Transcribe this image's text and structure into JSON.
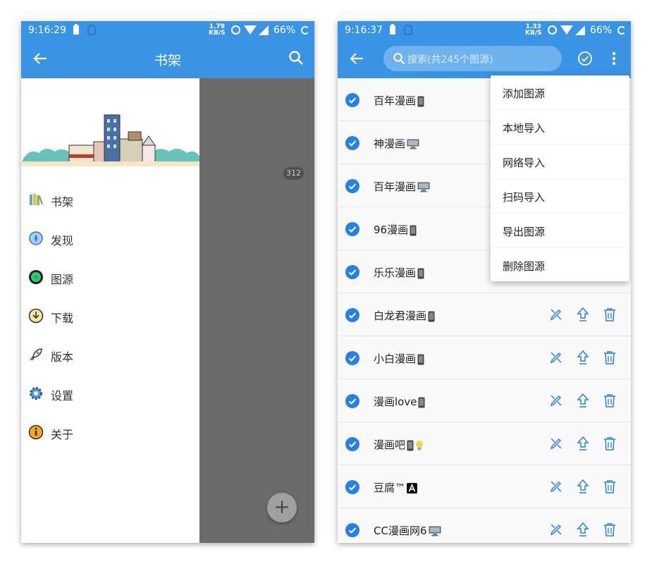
{
  "left": {
    "status": {
      "time": "9:16:29",
      "speed_value": "1.79",
      "speed_unit": "KB/S",
      "battery": "66%"
    },
    "toolbar": {
      "title": "书架"
    },
    "scrim": {
      "badge": "312",
      "fab": "+"
    },
    "menu": [
      {
        "label": "书架",
        "icon": "bookshelf-icon"
      },
      {
        "label": "发现",
        "icon": "compass-icon"
      },
      {
        "label": "图源",
        "icon": "source-icon"
      },
      {
        "label": "下载",
        "icon": "download-icon"
      },
      {
        "label": "版本",
        "icon": "rocket-icon"
      },
      {
        "label": "设置",
        "icon": "gear-icon"
      },
      {
        "label": "关于",
        "icon": "info-icon"
      }
    ]
  },
  "right": {
    "status": {
      "time": "9:16:37",
      "speed_value": "1.33",
      "speed_unit": "KB/S",
      "battery": "66%"
    },
    "search": {
      "placeholder": "搜索(共245个图源)"
    },
    "sources": [
      {
        "name": "百年漫画",
        "badge": "phone"
      },
      {
        "name": "神漫画",
        "badge": "desktop"
      },
      {
        "name": "百年漫画",
        "badge": "desktop"
      },
      {
        "name": "96漫画",
        "badge": "phone"
      },
      {
        "name": "乐乐漫画",
        "badge": "phone"
      },
      {
        "name": "白龙君漫画",
        "badge": "phone"
      },
      {
        "name": "小白漫画",
        "badge": "phone"
      },
      {
        "name": "漫画love",
        "badge": "phone"
      },
      {
        "name": "漫画吧",
        "badge": "phone+bulb"
      },
      {
        "name": "豆腐™",
        "badge": "A"
      },
      {
        "name": "CC漫画网6",
        "badge": "desktop"
      }
    ],
    "popup_menu": [
      "添加图源",
      "本地导入",
      "网络导入",
      "扫码导入",
      "导出图源",
      "删除图源"
    ],
    "colors": {
      "primary": "#3a93e4",
      "accent": "#2680e6"
    }
  }
}
